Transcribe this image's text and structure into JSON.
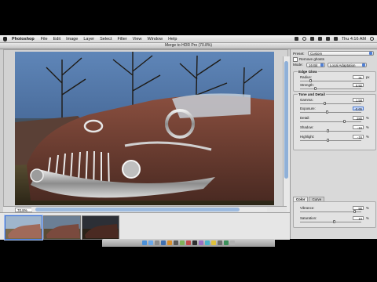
{
  "menubar": {
    "app_name": "Photoshop",
    "items": [
      "File",
      "Edit",
      "Image",
      "Layer",
      "Select",
      "Filter",
      "View",
      "Window",
      "Help"
    ],
    "clock": "Thu 4:16 AM"
  },
  "window": {
    "title": "Merge to HDR Pro (70.8%)"
  },
  "canvas": {
    "zoom": "70.8%"
  },
  "panel": {
    "preset_label": "Preset:",
    "preset_value": "Custom",
    "remove_ghosts_label": "Remove ghosts",
    "mode_label": "Mode:",
    "mode_value": "16 Bit",
    "method_value": "Local Adaptation",
    "edge_glow": {
      "title": "Edge Glow",
      "radius_label": "Radius:",
      "radius_value": "31",
      "radius_unit": "px",
      "strength_label": "Strength:",
      "strength_value": "0.92"
    },
    "tone_detail": {
      "title": "Tone and Detail",
      "gamma_label": "Gamma:",
      "gamma_value": "1.58",
      "exposure_label": "Exposure:",
      "exposure_value": "-0.65",
      "detail_label": "Detail:",
      "detail_value": "280",
      "detail_unit": "%",
      "shadow_label": "Shadow:",
      "shadow_value": "-16",
      "shadow_unit": "%",
      "highlight_label": "Highlight:",
      "highlight_value": "-16",
      "highlight_unit": "%"
    },
    "tabs": [
      "Color",
      "Curve"
    ],
    "color": {
      "vibrance_label": "Vibrance:",
      "vibrance_value": "90",
      "vibrance_unit": "%",
      "saturation_label": "Saturation:",
      "saturation_value": "10",
      "saturation_unit": "%"
    }
  },
  "colors": {
    "accent": "#3b6fd4",
    "menubar": "#e4e4e4",
    "panel": "#d9d9d9"
  }
}
